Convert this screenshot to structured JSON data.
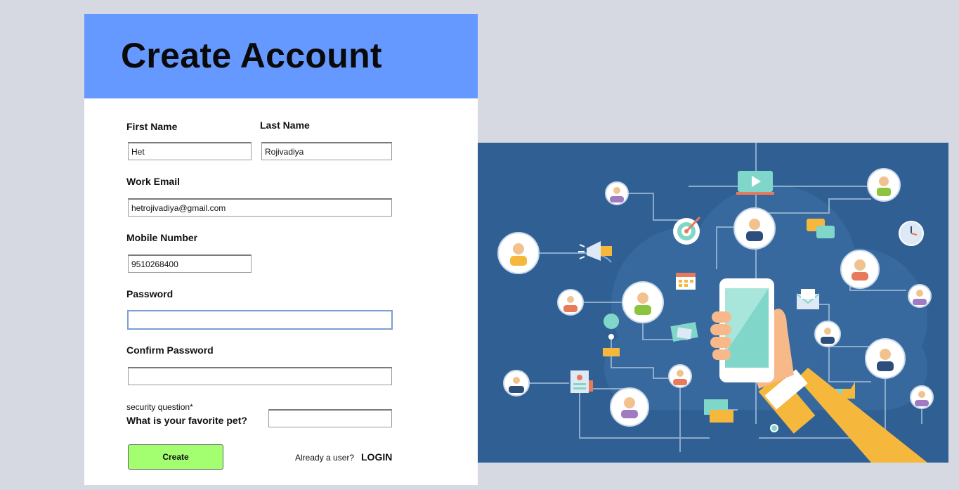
{
  "form": {
    "title": "Create Account",
    "first_name": {
      "label": "First Name",
      "value": "Het"
    },
    "last_name": {
      "label": "Last Name",
      "value": "Rojivadiya"
    },
    "work_email": {
      "label": "Work Email",
      "value": "hetrojivadiya@gmail.com"
    },
    "mobile": {
      "label": "Mobile Number",
      "value": "9510268400"
    },
    "password": {
      "label": "Password",
      "value": ""
    },
    "confirm_password": {
      "label": "Confirm Password",
      "value": ""
    },
    "security": {
      "hint": "security question*",
      "question": "What is your favorite pet?",
      "value": ""
    },
    "create_label": "Create",
    "already_text": "Already a user?",
    "login_label": "LOGIN"
  },
  "colors": {
    "header": "#6699ff",
    "create_button": "#a3ff70",
    "page_background": "#d6d9e1",
    "illustration_background": "#2f5f93"
  },
  "illustration": {
    "subject": "network of people connected to a smartphone held in a hand",
    "icons": [
      "person-avatar-icon",
      "video-play-icon",
      "target-icon",
      "megaphone-icon",
      "chat-bubbles-icon",
      "clock-icon",
      "calendar-icon",
      "mail-icon",
      "map-pin-icon",
      "id-card-icon",
      "thumbs-up-icon",
      "flag-icon",
      "credit-card-icon",
      "smartphone-icon"
    ]
  }
}
